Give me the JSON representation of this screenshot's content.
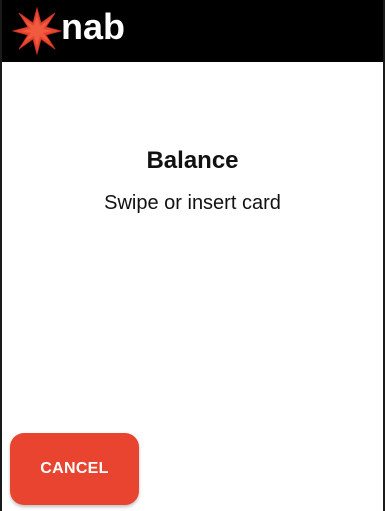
{
  "header": {
    "brand": "nab",
    "logo_icon": "nab-star-icon",
    "background_color": "#000000",
    "star_color": "#e8442f"
  },
  "main": {
    "title": "Balance",
    "instruction": "Swipe or insert card"
  },
  "actions": {
    "cancel_label": "CANCEL",
    "cancel_color": "#e8442f"
  }
}
